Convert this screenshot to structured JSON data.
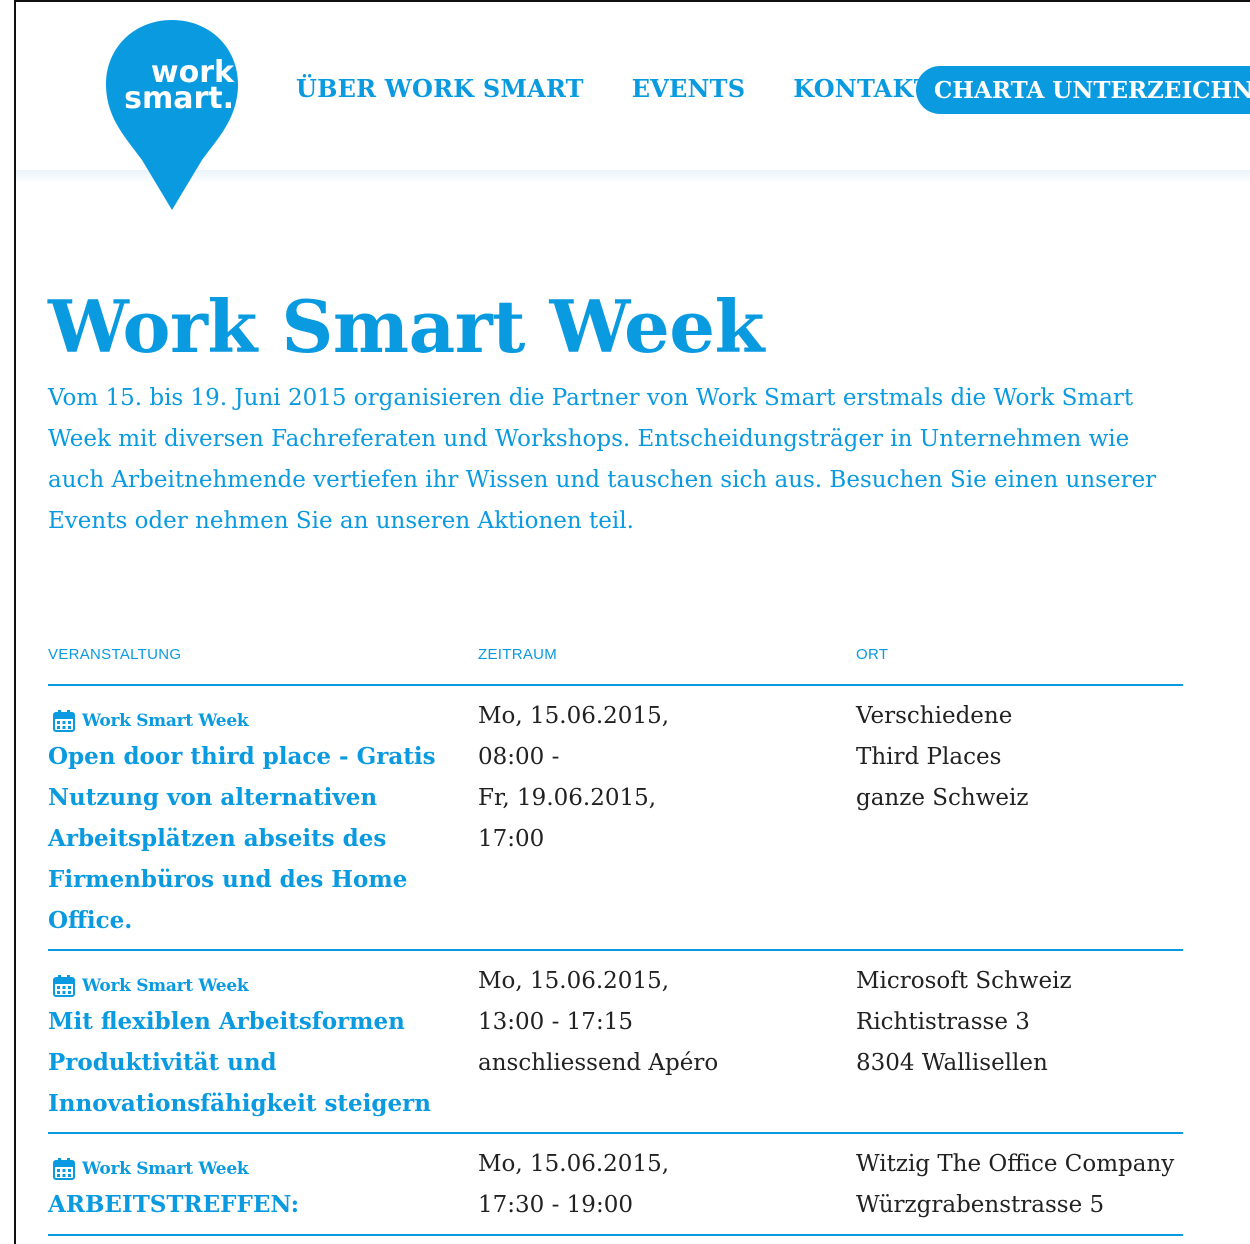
{
  "logo": {
    "line1": "work",
    "line2": "smart."
  },
  "nav": {
    "items": [
      "ÜBER WORK SMART",
      "EVENTS",
      "KONTAKT"
    ],
    "cta": "CHARTA UNTERZEICHNEN"
  },
  "page": {
    "title": "Work Smart Week",
    "intro": "Vom 15. bis 19. Juni 2015 organisieren die Partner von Work Smart erstmals die Work Smart Week mit diversen Fachreferaten und Workshops. Entscheidungsträger in Unternehmen wie auch Arbeitnehmende vertiefen ihr Wissen und tauschen sich aus. Besuchen Sie einen unserer Events oder nehmen Sie an unseren Aktionen teil."
  },
  "table": {
    "headers": [
      "VERANSTALTUNG",
      "ZEITRAUM",
      "ORT"
    ],
    "rows": [
      {
        "category": "Work Smart Week",
        "title": "Open door third place - Gratis Nutzung von alternativen Arbeitsplätzen abseits des Firmenbüros und des Home Office.",
        "time": "Mo, 15.06.2015,\n08:00 -\nFr, 19.06.2015,\n17:00",
        "place": "Verschiedene\nThird Places\nganze Schweiz"
      },
      {
        "category": "Work Smart Week",
        "title": "Mit flexiblen Arbeitsformen Produktivität und Innovationsfähigkeit steigern",
        "time": "Mo, 15.06.2015,\n13:00 - 17:15\nanschliessend Apéro",
        "place": "Microsoft Schweiz\nRichtistrasse 3\n8304 Wallisellen"
      },
      {
        "category": "Work Smart Week",
        "title": "ARBEITSTREFFEN:",
        "time": "Mo, 15.06.2015,\n17:30 - 19:00",
        "place": "Witzig The Office Company\nWürzgrabenstrasse 5"
      }
    ]
  },
  "colors": {
    "brand": "#0a9ae0",
    "text": "#222222"
  },
  "icons": {
    "category": "calendar-icon"
  }
}
